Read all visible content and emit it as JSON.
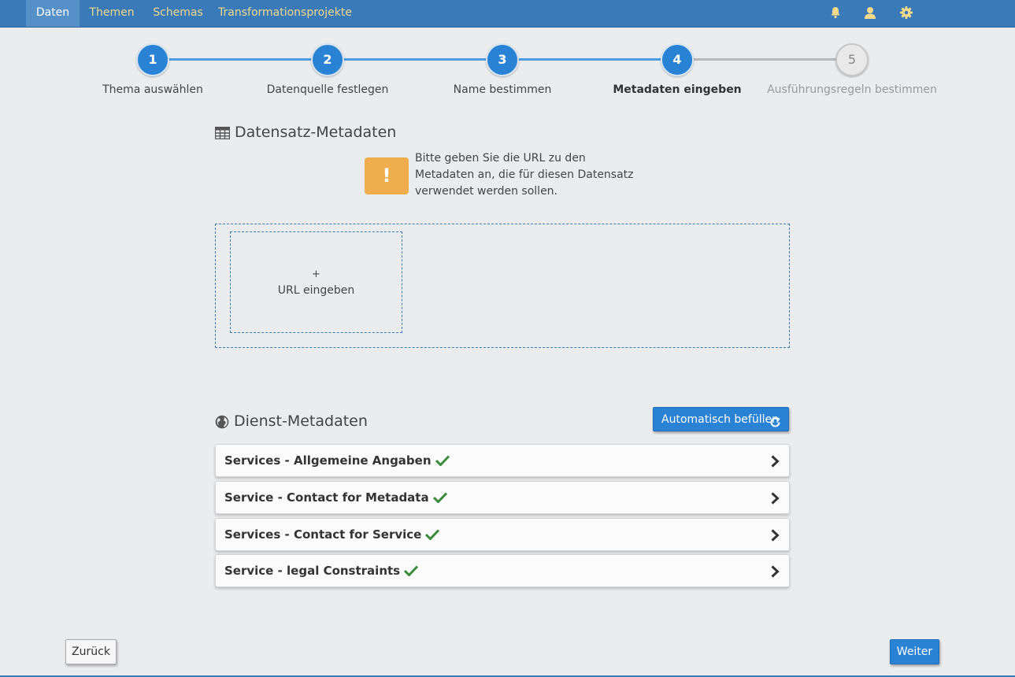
{
  "nav": {
    "items": [
      "Daten",
      "Themen",
      "Schemas",
      "Transformationsprojekte"
    ],
    "active": "Daten",
    "icons": [
      "bell-icon",
      "user-icon",
      "gear-icon"
    ]
  },
  "stepper": {
    "steps": [
      {
        "number": "1",
        "label": "Thema auswählen",
        "state": "done"
      },
      {
        "number": "2",
        "label": "Datenquelle festlegen",
        "state": "done"
      },
      {
        "number": "3",
        "label": "Name bestimmen",
        "state": "done"
      },
      {
        "number": "4",
        "label": "Metadaten eingeben",
        "state": "current"
      },
      {
        "number": "5",
        "label": "Ausführungsregeln bestimmen",
        "state": "pending"
      }
    ]
  },
  "dataset_section": {
    "title": "Datensatz-Metadaten",
    "icon": "table-icon",
    "warning_symbol": "!",
    "warning_text": "Bitte geben Sie die URL zu den Metadaten an, die für diesen Datensatz verwendet werden sollen.",
    "add_url_plus": "+",
    "add_url_label": "URL eingeben"
  },
  "service_section": {
    "title": "Dienst-Metadaten",
    "icon": "globe-icon",
    "autofill_label": "Automatisch befüllen",
    "panels": [
      {
        "title": "Services - Allgemeine Angaben",
        "complete": true
      },
      {
        "title": "Service - Contact for Metadata",
        "complete": true
      },
      {
        "title": "Services - Contact for Service",
        "complete": true
      },
      {
        "title": "Service - legal Constraints",
        "complete": true
      }
    ]
  },
  "footer": {
    "back_label": "Zurück",
    "next_label": "Weiter"
  },
  "colors": {
    "nav_bg": "#3a7ab8",
    "nav_active_bg": "#5590c8",
    "nav_text": "#f3d98a",
    "primary": "#2a82d4",
    "warning": "#f0ad4e",
    "check": "#3c8a3c",
    "page_bg": "#ebecee"
  }
}
